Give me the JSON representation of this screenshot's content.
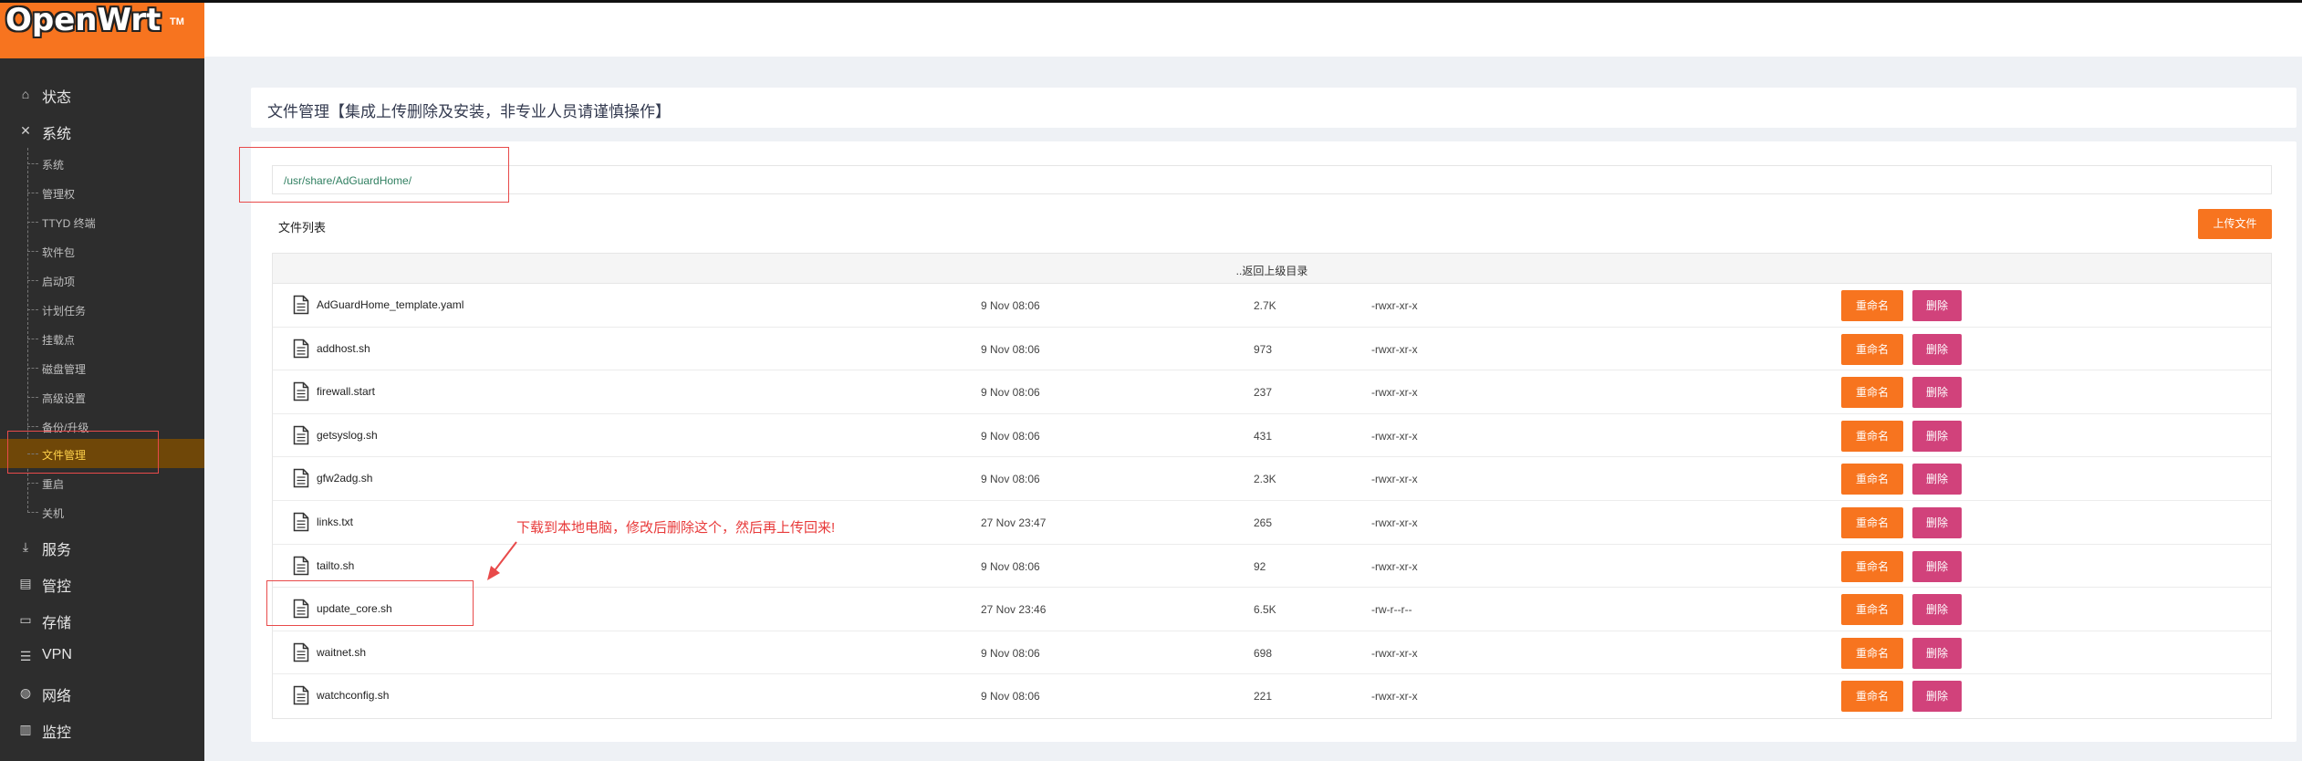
{
  "brand": {
    "name": "OpenWrt",
    "tm": "TM"
  },
  "sidebar": {
    "top_items": [
      {
        "label": "状态",
        "icon": "home-icon",
        "glyph": "⌂"
      },
      {
        "label": "系统",
        "icon": "tools-icon",
        "glyph": "✕"
      },
      {
        "label": "服务",
        "icon": "download-icon",
        "glyph": "⤓"
      },
      {
        "label": "管控",
        "icon": "calendar-icon",
        "glyph": "▤"
      },
      {
        "label": "存储",
        "icon": "printer-icon",
        "glyph": "▭"
      },
      {
        "label": "VPN",
        "icon": "bars-icon",
        "glyph": "☰"
      },
      {
        "label": "网络",
        "icon": "globe-icon",
        "glyph": "◍"
      },
      {
        "label": "监控",
        "icon": "chart-icon",
        "glyph": "▥"
      }
    ],
    "sub_items": [
      {
        "label": "系统"
      },
      {
        "label": "管理权"
      },
      {
        "label": "TTYD 终端"
      },
      {
        "label": "软件包"
      },
      {
        "label": "启动项"
      },
      {
        "label": "计划任务"
      },
      {
        "label": "挂载点"
      },
      {
        "label": "磁盘管理"
      },
      {
        "label": "高级设置"
      },
      {
        "label": "备份/升级"
      },
      {
        "label": "文件管理"
      },
      {
        "label": "重启"
      },
      {
        "label": "关机"
      }
    ],
    "active_sub": "文件管理"
  },
  "page": {
    "title": "文件管理【集成上传删除及安装，非专业人员请谨慎操作】",
    "path": "/usr/share/AdGuardHome/",
    "list_title": "文件列表",
    "upload_label": "上传文件",
    "parent_dir_label": "..返回上级目录",
    "rename_label": "重命名",
    "delete_label": "删除"
  },
  "files": [
    {
      "name": "AdGuardHome_template.yaml",
      "date": "9 Nov 08:06",
      "size": "2.7K",
      "perm": "-rwxr-xr-x"
    },
    {
      "name": "addhost.sh",
      "date": "9 Nov 08:06",
      "size": "973",
      "perm": "-rwxr-xr-x"
    },
    {
      "name": "firewall.start",
      "date": "9 Nov 08:06",
      "size": "237",
      "perm": "-rwxr-xr-x"
    },
    {
      "name": "getsyslog.sh",
      "date": "9 Nov 08:06",
      "size": "431",
      "perm": "-rwxr-xr-x"
    },
    {
      "name": "gfw2adg.sh",
      "date": "9 Nov 08:06",
      "size": "2.3K",
      "perm": "-rwxr-xr-x"
    },
    {
      "name": "links.txt",
      "date": "27 Nov 23:47",
      "size": "265",
      "perm": "-rwxr-xr-x"
    },
    {
      "name": "tailto.sh",
      "date": "9 Nov 08:06",
      "size": "92",
      "perm": "-rwxr-xr-x"
    },
    {
      "name": "update_core.sh",
      "date": "27 Nov 23:46",
      "size": "6.5K",
      "perm": "-rw-r--r--"
    },
    {
      "name": "waitnet.sh",
      "date": "9 Nov 08:06",
      "size": "698",
      "perm": "-rwxr-xr-x"
    },
    {
      "name": "watchconfig.sh",
      "date": "9 Nov 08:06",
      "size": "221",
      "perm": "-rwxr-xr-x"
    }
  ],
  "annotation": {
    "note": "下载到本地电脑，修改后删除这个，然后再上传回来!"
  },
  "colors": {
    "brand": "#f7741f",
    "sidebar": "#2d2d2d",
    "rename": "#f7741f",
    "delete": "#d1427b",
    "annotation": "#e84a4a"
  }
}
